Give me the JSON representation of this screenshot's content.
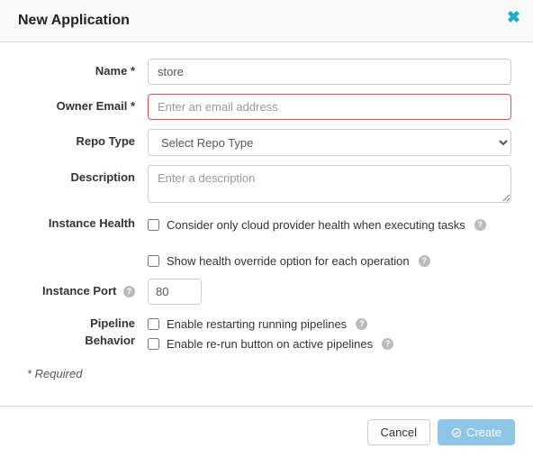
{
  "header": {
    "title": "New Application"
  },
  "labels": {
    "name": "Name *",
    "owner_email": "Owner Email *",
    "repo_type": "Repo Type",
    "description": "Description",
    "instance_health": "Instance Health",
    "instance_port": "Instance Port",
    "pipeline_behavior_line1": "Pipeline",
    "pipeline_behavior_line2": "Behavior"
  },
  "fields": {
    "name_value": "store",
    "owner_email_placeholder": "Enter an email address",
    "repo_type_selected": "Select Repo Type",
    "description_placeholder": "Enter a description",
    "instance_port_value": "80"
  },
  "checkboxes": {
    "cloud_health": "Consider only cloud provider health when executing tasks",
    "health_override": "Show health override option for each operation",
    "pipeline_restart": "Enable restarting running pipelines",
    "pipeline_rerun": "Enable re-run button on active pipelines"
  },
  "notes": {
    "required": "* Required"
  },
  "footer": {
    "cancel": "Cancel",
    "create": "Create"
  },
  "help_glyph": "?"
}
